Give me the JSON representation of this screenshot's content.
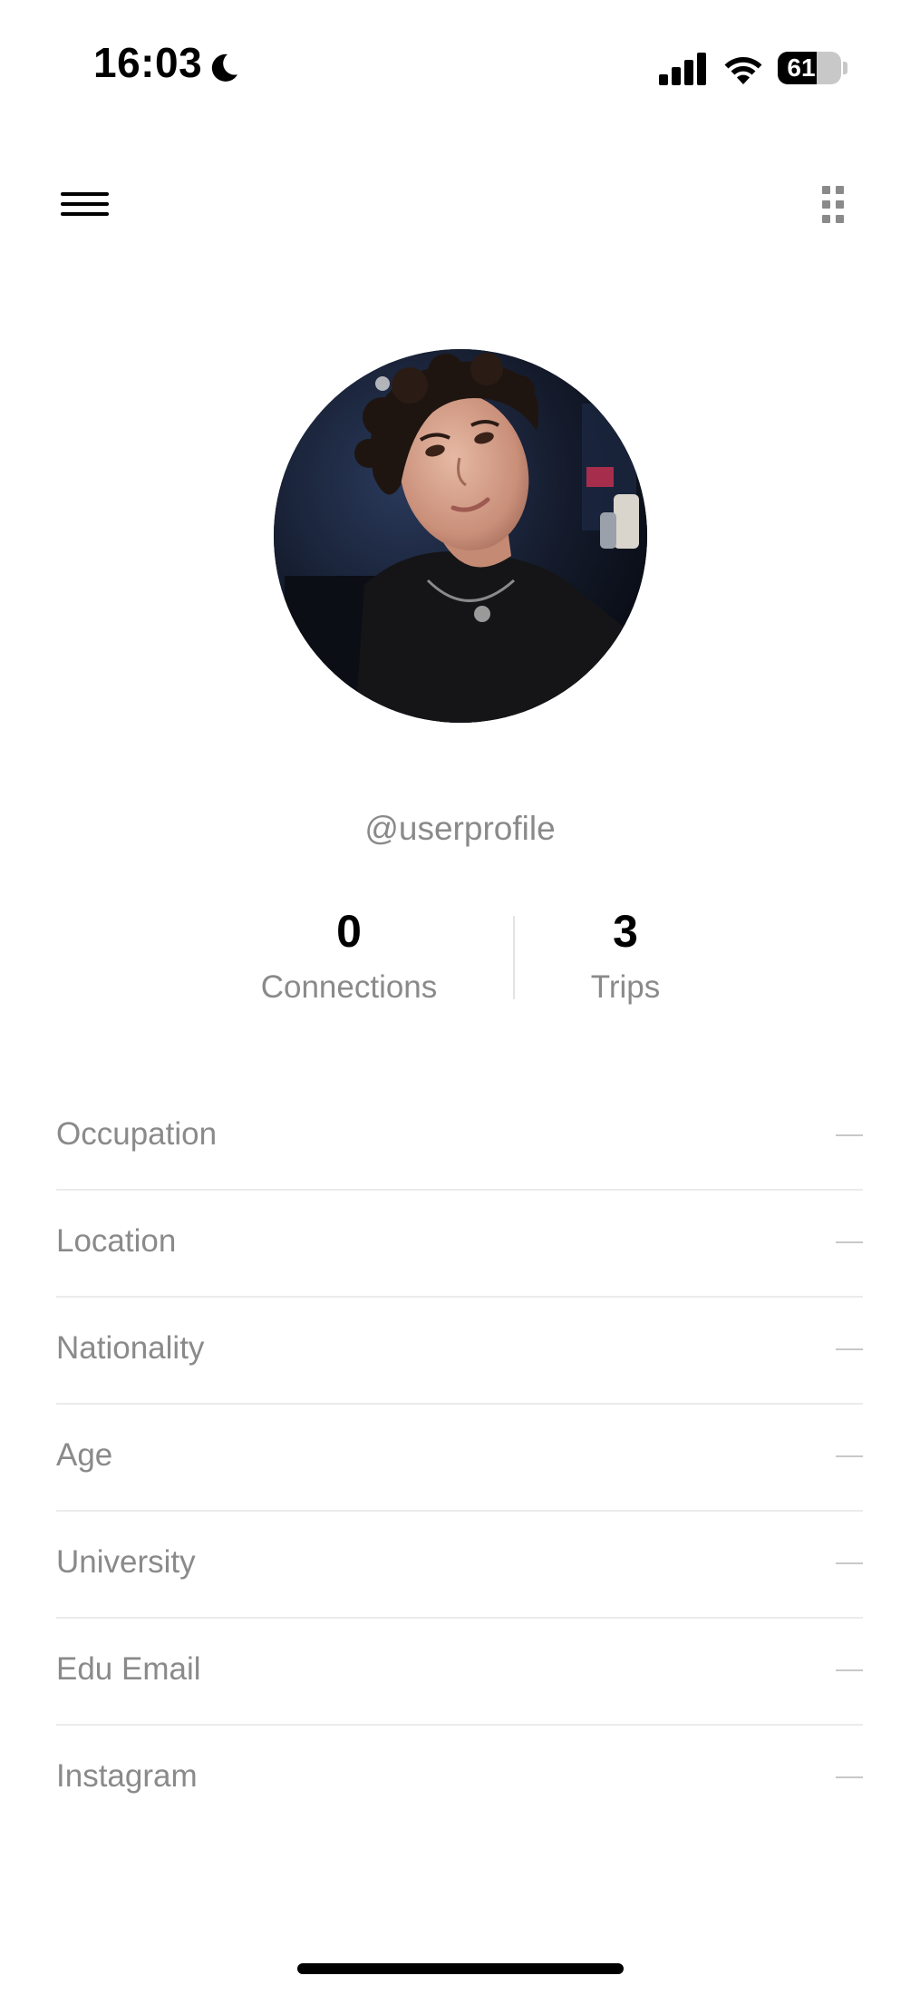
{
  "status_bar": {
    "time": "16:03",
    "battery": "61",
    "battery_level": 0.61,
    "icons": [
      "moon-icon",
      "signal-icon",
      "wifi-icon",
      "battery-icon"
    ]
  },
  "nav": {
    "menu_icon": "hamburger-menu-icon",
    "grid_icon": "grid-dots-icon"
  },
  "profile": {
    "username": "@userprofile",
    "avatar": "profile-photo"
  },
  "stats": {
    "connections": {
      "value": "0",
      "label": "Connections"
    },
    "trips": {
      "value": "3",
      "label": "Trips"
    }
  },
  "details": [
    {
      "label": "Occupation",
      "value": "—"
    },
    {
      "label": "Location",
      "value": "—"
    },
    {
      "label": "Nationality",
      "value": "—"
    },
    {
      "label": "Age",
      "value": "—"
    },
    {
      "label": "University",
      "value": "—"
    },
    {
      "label": "Edu Email",
      "value": "—"
    },
    {
      "label": "Instagram",
      "value": "—"
    }
  ],
  "colors": {
    "primary_text": "#000000",
    "secondary_text": "#8a8a8a",
    "divider": "#ebebeb",
    "placeholder_dash": "#c8c8c8"
  }
}
